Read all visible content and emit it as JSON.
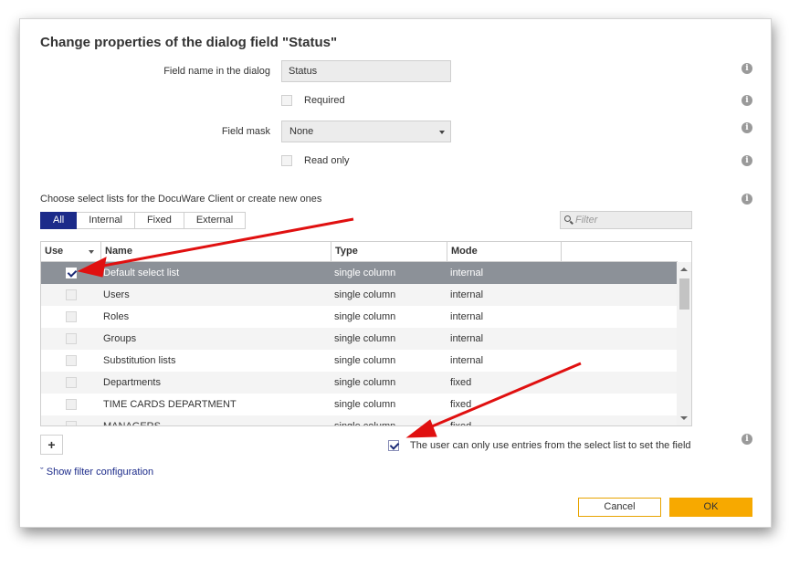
{
  "dialog": {
    "title": "Change properties of the dialog field \"Status\"",
    "field_name_label": "Field name in the dialog",
    "field_name_value": "Status",
    "required_label": "Required",
    "required_checked": false,
    "field_mask_label": "Field mask",
    "field_mask_value": "None",
    "read_only_label": "Read only",
    "read_only_checked": false,
    "select_lists_label": "Choose select lists for the DocuWare Client or create new ones",
    "info_icon": "i"
  },
  "tabs": [
    {
      "label": "All",
      "active": true
    },
    {
      "label": "Internal",
      "active": false
    },
    {
      "label": "Fixed",
      "active": false
    },
    {
      "label": "External",
      "active": false
    }
  ],
  "filter": {
    "placeholder": "Filter"
  },
  "table": {
    "columns": [
      "Use",
      "Name",
      "Type",
      "Mode"
    ],
    "rows": [
      {
        "use": true,
        "name": "Default select list",
        "type": "single column",
        "mode": "internal",
        "selected": true
      },
      {
        "use": false,
        "name": "Users",
        "type": "single column",
        "mode": "internal"
      },
      {
        "use": false,
        "name": "Roles",
        "type": "single column",
        "mode": "internal"
      },
      {
        "use": false,
        "name": "Groups",
        "type": "single column",
        "mode": "internal"
      },
      {
        "use": false,
        "name": "Substitution lists",
        "type": "single column",
        "mode": "internal"
      },
      {
        "use": false,
        "name": "Departments",
        "type": "single column",
        "mode": "fixed"
      },
      {
        "use": false,
        "name": "TIME CARDS DEPARTMENT",
        "type": "single column",
        "mode": "fixed"
      },
      {
        "use": false,
        "name": "MANAGERS",
        "type": "single column",
        "mode": "fixed"
      }
    ]
  },
  "add_button": "+",
  "restrict_entries": {
    "checked": true,
    "label": "The user can only use entries from the select list to set the field"
  },
  "show_filter_label": "Show filter configuration",
  "buttons": {
    "cancel": "Cancel",
    "ok": "OK"
  },
  "colors": {
    "accent": "#1c2b8a",
    "ok_button": "#f7a900",
    "selected_row": "#8c9198",
    "annotation_arrow": "#e01010"
  }
}
